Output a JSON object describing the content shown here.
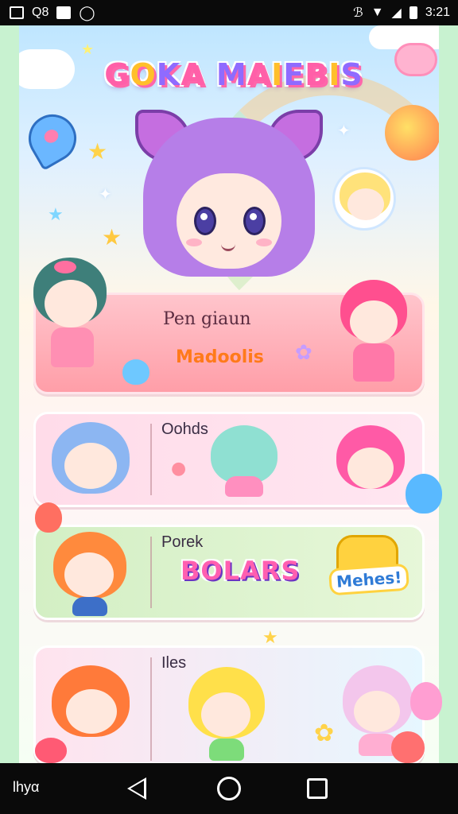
{
  "status_bar": {
    "left_text": "Q8",
    "time": "3:21"
  },
  "game": {
    "title": "GOKA MAIEBIS",
    "hero_card": {
      "line1": "Pen giaun",
      "line2": "Madoolis"
    },
    "rows": [
      {
        "label": "Oohds"
      },
      {
        "label": "Porek",
        "badge": "BOLARS",
        "sticker": "Mehes!"
      },
      {
        "label": "Iles"
      }
    ]
  },
  "nav_bar": {
    "left_label": "lhyα"
  },
  "colors": {
    "accent_pink": "#ff5fa8",
    "accent_yellow": "#ffcc33",
    "accent_purple": "#8f6bff",
    "panel_green": "#c8f2d0"
  },
  "icons": [
    "image-icon",
    "notification-icon",
    "bluetooth-icon",
    "wifi-icon",
    "signal-icon",
    "battery-icon",
    "back-icon",
    "home-icon",
    "recents-icon"
  ]
}
